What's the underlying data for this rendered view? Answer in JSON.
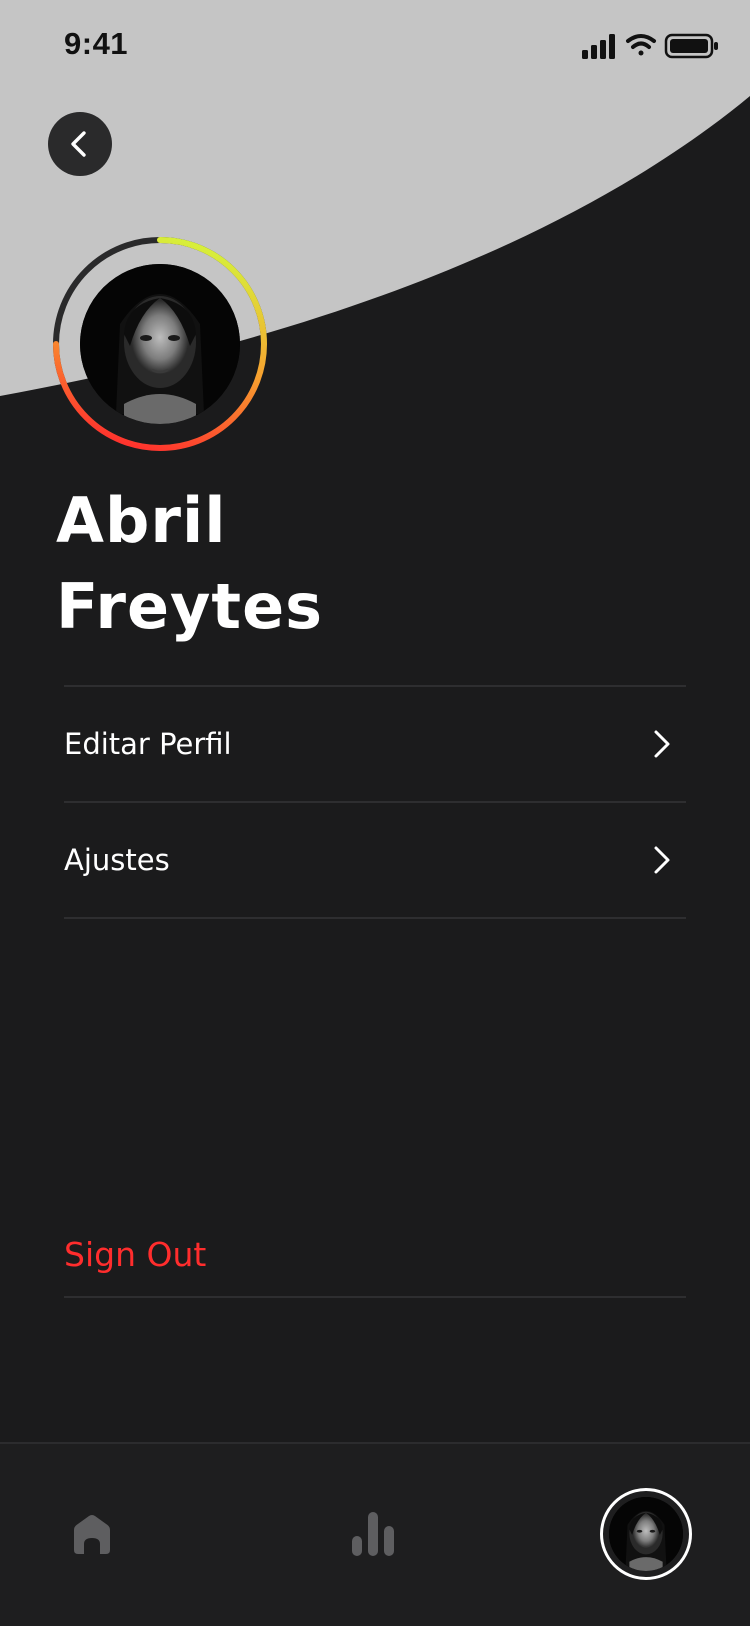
{
  "status_bar": {
    "time": "9:41"
  },
  "header": {
    "back_icon": "chevron-left-icon"
  },
  "profile": {
    "name_line1": "Abril",
    "name_line2": "Freytes",
    "avatar_alt": "profile-photo"
  },
  "menu": {
    "items": [
      {
        "label": "Editar Perfil",
        "icon": "chevron-right-icon"
      },
      {
        "label": "Ajustes",
        "icon": "chevron-right-icon"
      }
    ]
  },
  "signout": {
    "label": "Sign Out"
  },
  "tab_bar": {
    "items": [
      {
        "name": "home",
        "icon": "home-icon"
      },
      {
        "name": "stats",
        "icon": "bar-chart-icon"
      },
      {
        "name": "profile",
        "icon": "avatar"
      }
    ]
  },
  "colors": {
    "background": "#1b1b1c",
    "header_curve": "#c5c5c5",
    "accent_red": "#ff2d2d",
    "ring_gradient_start": "#d7ef3a",
    "ring_gradient_mid": "#f7a12f",
    "ring_gradient_end": "#ff2d2d"
  }
}
